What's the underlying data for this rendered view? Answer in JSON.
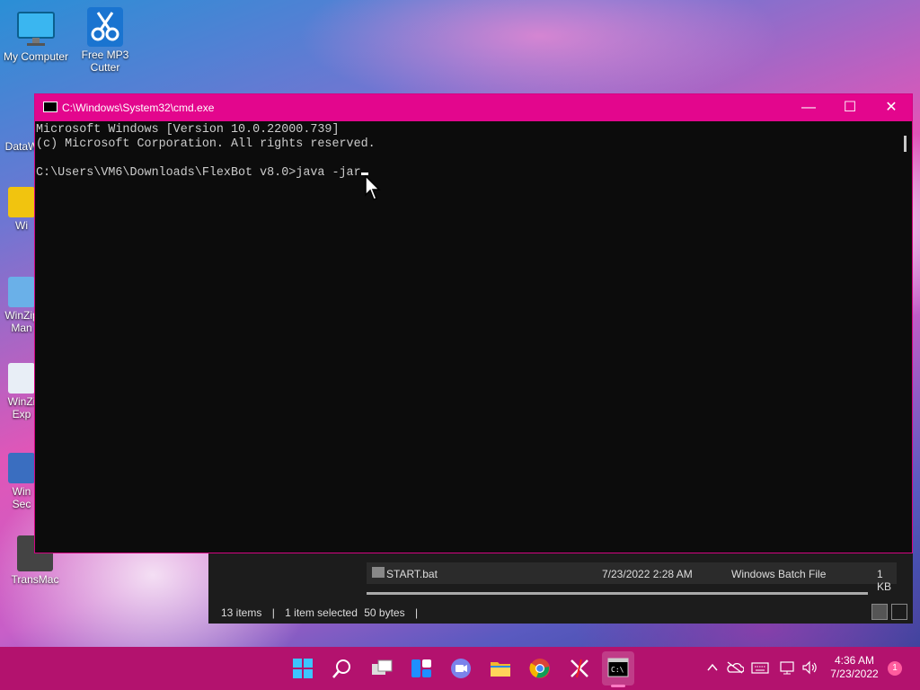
{
  "desktop": {
    "icons": [
      {
        "label": "My Computer",
        "icon": "monitor-icon"
      },
      {
        "label": "Free MP3 Cutter",
        "icon": "scissors-icon"
      }
    ],
    "partial_icons": [
      {
        "label": "DataW",
        "icon": "app-shortcut-icon"
      },
      {
        "label": "Wi",
        "icon": "folder-shortcut-icon"
      },
      {
        "label": "WinZip Man",
        "icon": "image-shortcut-icon"
      },
      {
        "label": "WinZi Exp",
        "icon": "pdf-shortcut-icon"
      },
      {
        "label": "Win Sec",
        "icon": "server-shortcut-icon"
      },
      {
        "label": "TransMac",
        "icon": "transmac-icon"
      }
    ]
  },
  "cmd": {
    "title": "C:\\Windows\\System32\\cmd.exe",
    "lines": [
      "Microsoft Windows [Version 10.0.22000.739]",
      "(c) Microsoft Corporation. All rights reserved.",
      "",
      "C:\\Users\\VM6\\Downloads\\FlexBot v8.0>java -jar"
    ],
    "controls": {
      "minimize": "—",
      "maximize": "☐",
      "close": "✕"
    }
  },
  "explorer": {
    "file": {
      "name": "START.bat",
      "date": "7/23/2022 2:28 AM",
      "type": "Windows Batch File",
      "size": "1 KB"
    },
    "status": {
      "items": "13 items",
      "selected": "1 item selected",
      "size": "50 bytes"
    }
  },
  "taskbar": {
    "icons": [
      "windows-start-icon",
      "search-icon",
      "task-view-icon",
      "widgets-icon",
      "teams-chat-icon",
      "file-explorer-icon",
      "chrome-icon",
      "capcut-icon",
      "terminal-icon"
    ],
    "clock": {
      "time": "4:36 AM",
      "date": "7/23/2022"
    },
    "notification_count": "1",
    "accent": "#b3126e"
  }
}
